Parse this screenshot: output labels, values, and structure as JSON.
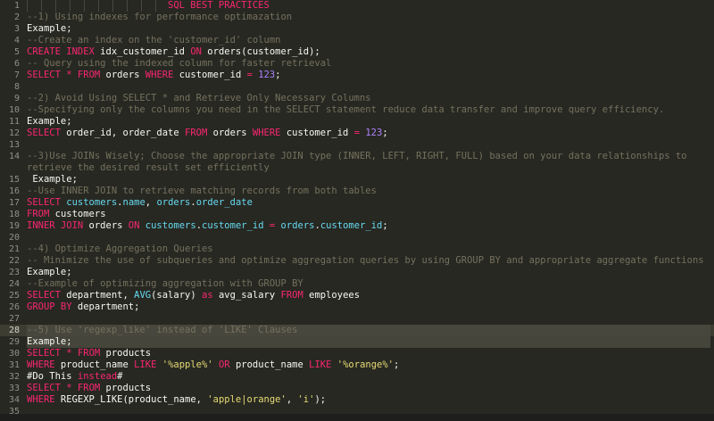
{
  "editor": {
    "title_line": "SQL BEST PRACTICES",
    "lines": [
      {
        "n": "1",
        "segs": [
          [
            "title",
            "SQL BEST PRACTICES"
          ]
        ]
      },
      {
        "n": "2",
        "segs": [
          [
            "c",
            "--1) Using indexes for performance optimazation"
          ]
        ]
      },
      {
        "n": "3",
        "segs": [
          [
            "p",
            "Example;"
          ]
        ]
      },
      {
        "n": "4",
        "segs": [
          [
            "c",
            "--Create an index on the 'customer_id' column"
          ]
        ]
      },
      {
        "n": "5",
        "segs": [
          [
            "k",
            "CREATE INDEX"
          ],
          [
            "p",
            " idx_customer_id "
          ],
          [
            "k",
            "ON"
          ],
          [
            "p",
            " orders(customer_id);"
          ]
        ]
      },
      {
        "n": "6",
        "segs": [
          [
            "c",
            "-- Query using the indexed column for faster retrieval"
          ]
        ]
      },
      {
        "n": "7",
        "segs": [
          [
            "k",
            "SELECT"
          ],
          [
            "p",
            " "
          ],
          [
            "k",
            "*"
          ],
          [
            "p",
            " "
          ],
          [
            "k",
            "FROM"
          ],
          [
            "p",
            " orders "
          ],
          [
            "k",
            "WHERE"
          ],
          [
            "p",
            " customer_id "
          ],
          [
            "k",
            "="
          ],
          [
            "p",
            " "
          ],
          [
            "n",
            "123"
          ],
          [
            "p",
            ";"
          ]
        ]
      },
      {
        "n": "8",
        "segs": [
          [
            "p",
            ""
          ]
        ]
      },
      {
        "n": "9",
        "segs": [
          [
            "c",
            "--2) Avoid Using SELECT * and Retrieve Only Necessary Columns"
          ]
        ]
      },
      {
        "n": "10",
        "segs": [
          [
            "c",
            "--Specifying only the columns you need in the SELECT statement reduce data transfer and improve query efficiency."
          ]
        ]
      },
      {
        "n": "11",
        "segs": [
          [
            "p",
            "Example;"
          ]
        ]
      },
      {
        "n": "12",
        "segs": [
          [
            "k",
            "SELECT"
          ],
          [
            "p",
            " order_id, order_date "
          ],
          [
            "k",
            "FROM"
          ],
          [
            "p",
            " orders "
          ],
          [
            "k",
            "WHERE"
          ],
          [
            "p",
            " customer_id "
          ],
          [
            "k",
            "="
          ],
          [
            "p",
            " "
          ],
          [
            "n",
            "123"
          ],
          [
            "p",
            ";"
          ]
        ]
      },
      {
        "n": "13",
        "segs": [
          [
            "p",
            ""
          ]
        ]
      },
      {
        "n": "14",
        "segs": [
          [
            "c",
            "--3)Use JOINs Wisely; Choose the appropriate JOIN type (INNER, LEFT, RIGHT, FULL) based on your data relationships to retrieve the desired result set efficiently"
          ]
        ],
        "wrap": true
      },
      {
        "n": "15",
        "segs": [
          [
            "p",
            " Example;"
          ]
        ]
      },
      {
        "n": "16",
        "segs": [
          [
            "c",
            "--Use INNER JOIN to retrieve matching records from both tables"
          ]
        ]
      },
      {
        "n": "17",
        "segs": [
          [
            "k",
            "SELECT"
          ],
          [
            "p",
            " "
          ],
          [
            "f",
            "customers"
          ],
          [
            "p",
            "."
          ],
          [
            "f",
            "name"
          ],
          [
            "p",
            ", "
          ],
          [
            "f",
            "orders"
          ],
          [
            "p",
            "."
          ],
          [
            "f",
            "order_date"
          ]
        ]
      },
      {
        "n": "18",
        "segs": [
          [
            "k",
            "FROM"
          ],
          [
            "p",
            " customers"
          ]
        ]
      },
      {
        "n": "19",
        "segs": [
          [
            "k",
            "INNER JOIN"
          ],
          [
            "p",
            " orders "
          ],
          [
            "k",
            "ON"
          ],
          [
            "p",
            " "
          ],
          [
            "f",
            "customers"
          ],
          [
            "p",
            "."
          ],
          [
            "f",
            "customer_id"
          ],
          [
            "p",
            " "
          ],
          [
            "k",
            "="
          ],
          [
            "p",
            " "
          ],
          [
            "f",
            "orders"
          ],
          [
            "p",
            "."
          ],
          [
            "f",
            "customer_id"
          ],
          [
            "p",
            ";"
          ]
        ]
      },
      {
        "n": "20",
        "segs": [
          [
            "p",
            ""
          ]
        ]
      },
      {
        "n": "21",
        "segs": [
          [
            "c",
            "--4) Optimize Aggregation Queries"
          ]
        ]
      },
      {
        "n": "22",
        "segs": [
          [
            "c",
            "-- Minimize the use of subqueries and optimize aggregation queries by using GROUP BY and appropriate aggregate functions"
          ]
        ]
      },
      {
        "n": "23",
        "segs": [
          [
            "p",
            "Example;"
          ]
        ]
      },
      {
        "n": "24",
        "segs": [
          [
            "c",
            "--Example of optimizing aggregation with GROUP BY"
          ]
        ]
      },
      {
        "n": "25",
        "segs": [
          [
            "k",
            "SELECT"
          ],
          [
            "p",
            " department, "
          ],
          [
            "f",
            "AVG"
          ],
          [
            "p",
            "(salary) "
          ],
          [
            "k",
            "as"
          ],
          [
            "p",
            " avg_salary "
          ],
          [
            "k",
            "FROM"
          ],
          [
            "p",
            " employees"
          ]
        ]
      },
      {
        "n": "26",
        "segs": [
          [
            "k",
            "GROUP BY"
          ],
          [
            "p",
            " department;"
          ]
        ]
      },
      {
        "n": "27",
        "segs": [
          [
            "p",
            ""
          ]
        ]
      },
      {
        "n": "28",
        "segs": [
          [
            "c",
            "--5) Use 'regexp_like' instead of 'LIKE' Clauses"
          ]
        ],
        "sel": true,
        "active": true
      },
      {
        "n": "29",
        "segs": [
          [
            "p",
            "Example;"
          ]
        ],
        "sel": true
      },
      {
        "n": "30",
        "segs": [
          [
            "k",
            "SELECT"
          ],
          [
            "p",
            " "
          ],
          [
            "k",
            "*"
          ],
          [
            "p",
            " "
          ],
          [
            "k",
            "FROM"
          ],
          [
            "p",
            " products"
          ]
        ]
      },
      {
        "n": "31",
        "segs": [
          [
            "k",
            "WHERE"
          ],
          [
            "p",
            " product_name "
          ],
          [
            "k",
            "LIKE"
          ],
          [
            "p",
            " "
          ],
          [
            "s",
            "'%apple%'"
          ],
          [
            "p",
            " "
          ],
          [
            "k",
            "OR"
          ],
          [
            "p",
            " product_name "
          ],
          [
            "k",
            "LIKE"
          ],
          [
            "p",
            " "
          ],
          [
            "s",
            "'%orange%'"
          ],
          [
            "p",
            ";"
          ]
        ]
      },
      {
        "n": "32",
        "segs": [
          [
            "p",
            "#Do This "
          ],
          [
            "k",
            "instead"
          ],
          [
            "p",
            "#"
          ]
        ]
      },
      {
        "n": "33",
        "segs": [
          [
            "k",
            "SELECT"
          ],
          [
            "p",
            " "
          ],
          [
            "k",
            "*"
          ],
          [
            "p",
            " "
          ],
          [
            "k",
            "FROM"
          ],
          [
            "p",
            " products"
          ]
        ]
      },
      {
        "n": "34",
        "segs": [
          [
            "k",
            "WHERE"
          ],
          [
            "p",
            " REGEXP_LIKE(product_name, "
          ],
          [
            "s",
            "'apple|orange'"
          ],
          [
            "p",
            ", "
          ],
          [
            "s",
            "'i'"
          ],
          [
            "p",
            ");"
          ]
        ]
      },
      {
        "n": "35",
        "segs": [
          [
            "p",
            ""
          ]
        ]
      }
    ]
  },
  "colors": {
    "background": "#272822",
    "keyword": "#f92672",
    "comment": "#75715e",
    "string": "#e6db74",
    "function": "#66d9ef",
    "number": "#ae81ff"
  }
}
